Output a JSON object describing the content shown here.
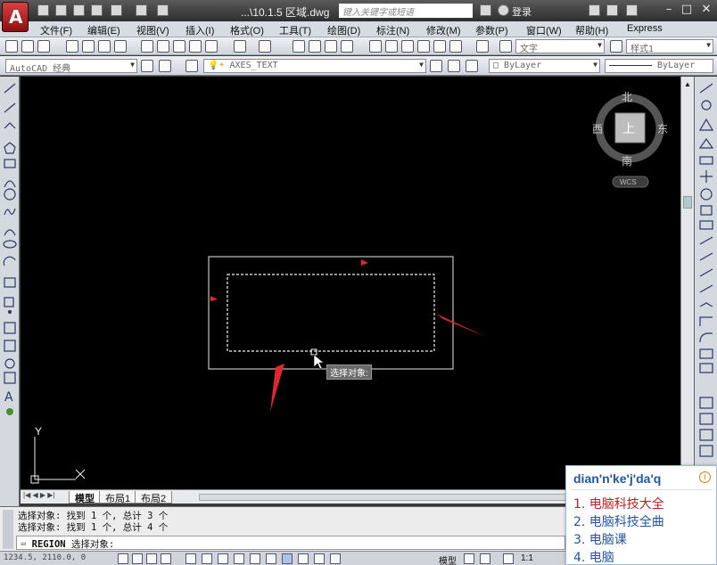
{
  "window": {
    "doc_title": "...\\10.1.5 区域.dwg",
    "search_placeholder": "键入关键字或短语",
    "login_label": "登录"
  },
  "menu": [
    "文件(F)",
    "编辑(E)",
    "视图(V)",
    "插入(I)",
    "格式(O)",
    "工具(T)",
    "绘图(D)",
    "标注(N)",
    "修改(M)",
    "参数(P)",
    "窗口(W)",
    "帮助(H)",
    "Express"
  ],
  "toolbar": {
    "text_style": "文字",
    "dim_style": "样式1",
    "workspace": "AutoCAD 经典",
    "layer": "AXES_TEXT",
    "color": "ByLayer",
    "linetype": "ByLayer"
  },
  "viewcube": {
    "north": "北",
    "south": "南",
    "east": "东",
    "west": "西",
    "top": "上",
    "wcs": "WCS"
  },
  "canvas": {
    "tooltip": "选择对象:",
    "axis_y": "Y"
  },
  "tabs": [
    "模型",
    "布局1",
    "布局2"
  ],
  "command": {
    "history": [
      "选择对象: 找到 1 个, 总计 3 个",
      "选择对象: 找到 1 个, 总计 4 个"
    ],
    "current_command": "REGION",
    "prompt": "选择对象:"
  },
  "status": {
    "coords": "1234.5, 2110.0, 0",
    "model": "模型",
    "scale": "1:1"
  },
  "ime": {
    "input": "dian'n'ke'j'da'q",
    "candidates": [
      "1. 电脑科技大全",
      "2. 电脑科技全曲",
      "3. 电脑课",
      "4. 电脑"
    ]
  },
  "colors": {
    "canvas_bg": "#000000",
    "annotation_arrow": "#e0282c",
    "title_bar": "#3a3a3a"
  }
}
